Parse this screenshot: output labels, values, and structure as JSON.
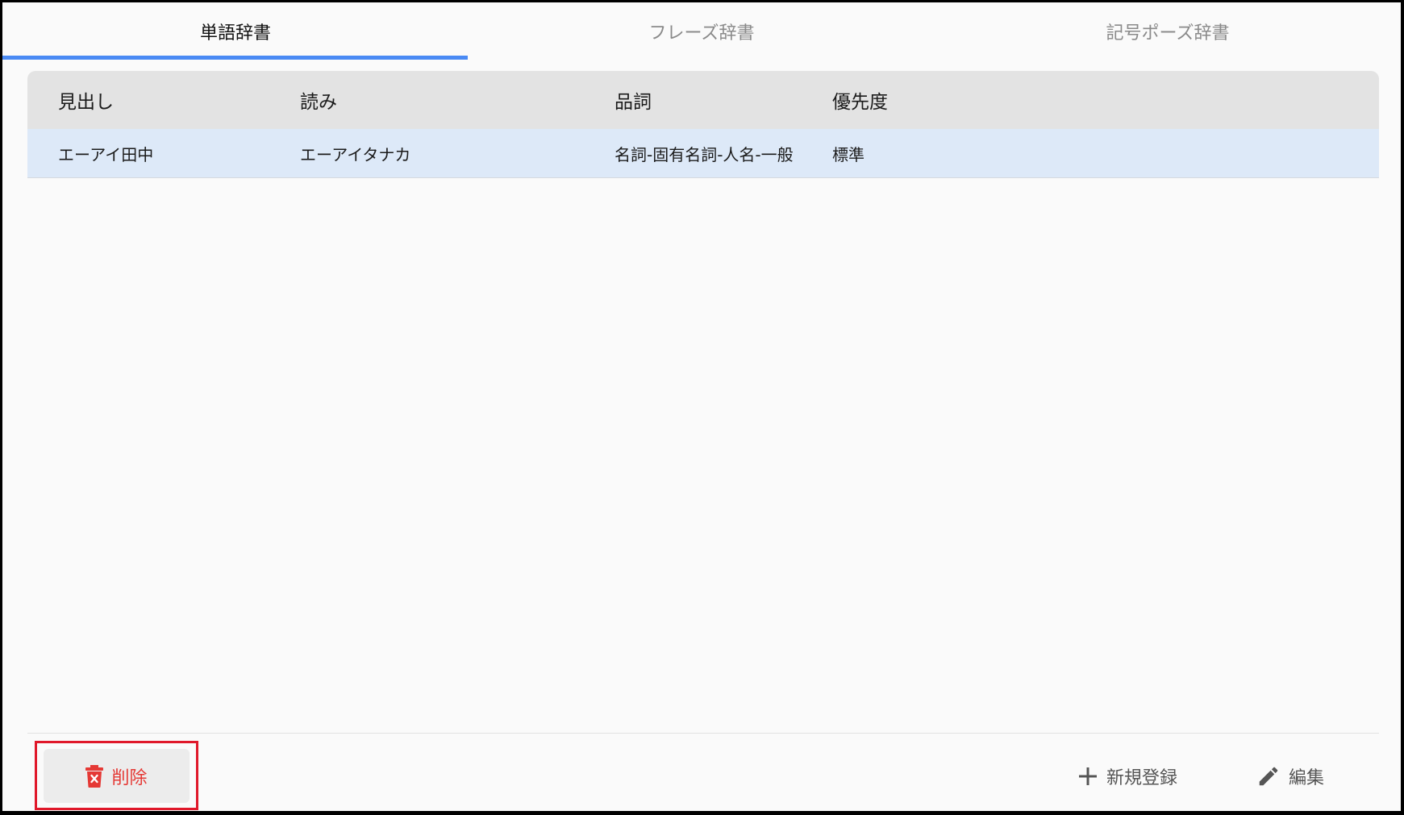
{
  "tabs": [
    {
      "label": "単語辞書",
      "active": true
    },
    {
      "label": "フレーズ辞書",
      "active": false
    },
    {
      "label": "記号ポーズ辞書",
      "active": false
    }
  ],
  "table": {
    "columns": [
      "見出し",
      "読み",
      "品詞",
      "優先度"
    ],
    "rows": [
      [
        "エーアイ田中",
        "エーアイタナカ",
        "名詞-固有名詞-人名-一般",
        "標準"
      ]
    ]
  },
  "footer": {
    "delete_label": "削除",
    "new_label": "新規登録",
    "edit_label": "編集"
  },
  "colors": {
    "accent": "#4a8af4",
    "danger": "#e53935",
    "selected_row": "#dde9f8",
    "header_bg": "#e3e3e3"
  },
  "icons": {
    "delete": "trash-x-icon",
    "new": "plus-icon",
    "edit": "pencil-icon"
  }
}
